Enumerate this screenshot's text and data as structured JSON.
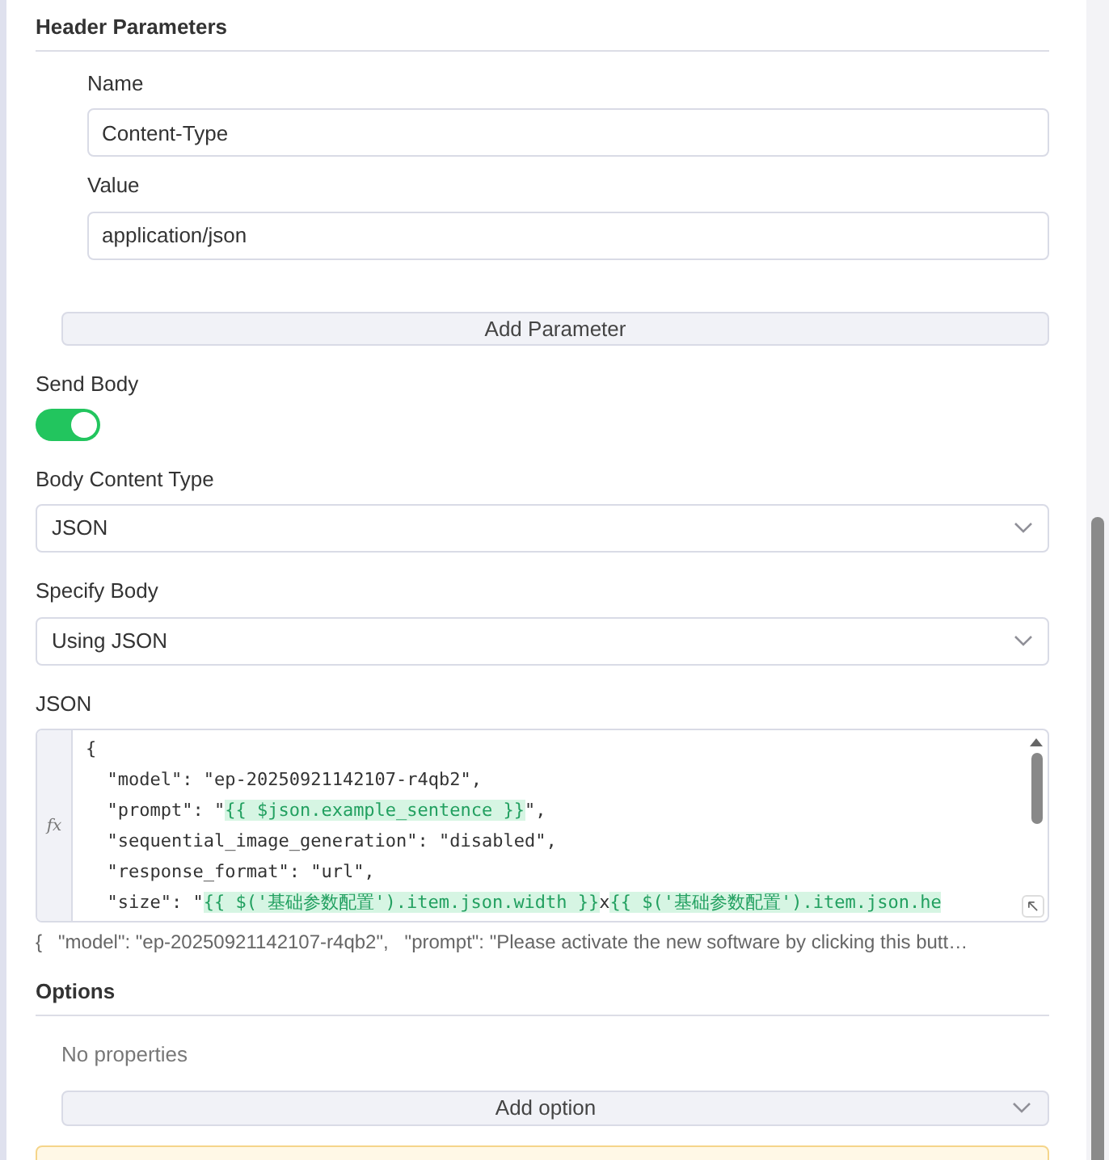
{
  "header_parameters": {
    "title": "Header Parameters",
    "params": [
      {
        "label": "Name",
        "value": "Content-Type"
      },
      {
        "label": "Value",
        "value": "application/json"
      }
    ],
    "add_button": "Add Parameter"
  },
  "send_body": {
    "label": "Send Body",
    "on": true
  },
  "selects": [
    {
      "label": "Body Content Type",
      "value": "JSON"
    },
    {
      "label": "Specify Body",
      "value": "Using JSON"
    }
  ],
  "json_editor": {
    "label": "JSON",
    "fx": "fx",
    "lines": [
      [
        {
          "kind": "plain",
          "text": "{"
        }
      ],
      [
        {
          "kind": "plain",
          "text": "  \"model\": \"ep-20250921142107-r4qb2\","
        }
      ],
      [
        {
          "kind": "plain",
          "text": "  \"prompt\": \""
        },
        {
          "kind": "expr",
          "text": "{{ $json.example_sentence }}"
        },
        {
          "kind": "plain",
          "text": "\","
        }
      ],
      [
        {
          "kind": "plain",
          "text": "  \"sequential_image_generation\": \"disabled\","
        }
      ],
      [
        {
          "kind": "plain",
          "text": "  \"response_format\": \"url\","
        }
      ],
      [
        {
          "kind": "plain",
          "text": "  \"size\": \""
        },
        {
          "kind": "expr",
          "text": "{{ $('基础参数配置').item.json.width }}"
        },
        {
          "kind": "plain",
          "text": "x"
        },
        {
          "kind": "expr",
          "text": "{{ $('基础参数配置').item.json.he"
        }
      ]
    ],
    "preview": "{   \"model\": \"ep-20250921142107-r4qb2\",   \"prompt\": \"Please activate the new software by clicking this butt…"
  },
  "options": {
    "title": "Options",
    "empty": "No properties",
    "add_button": "Add option"
  }
}
